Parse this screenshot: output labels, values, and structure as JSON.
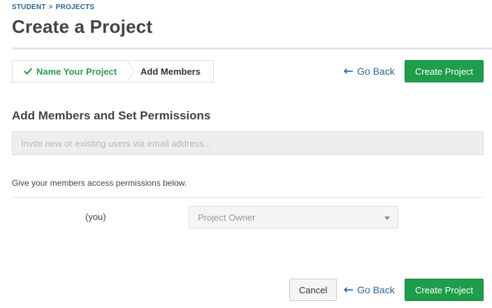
{
  "breadcrumb": {
    "root": "STUDENT",
    "separator": ">",
    "current": "PROJECTS"
  },
  "page": {
    "title": "Create a Project"
  },
  "wizard": {
    "steps": [
      {
        "label": "Name Your Project",
        "status": "done",
        "icon": "check-icon"
      },
      {
        "label": "Add Members",
        "status": "current"
      }
    ]
  },
  "actions_top": {
    "back_label": "Go Back",
    "create_label": "Create Project"
  },
  "members_section": {
    "title": "Add Members and Set Permissions",
    "invite_placeholder": "Invite new or existing users via email address...",
    "invite_value": "",
    "help_text": "Give your members access permissions below.",
    "members": [
      {
        "name": "(you)",
        "role": "Project Owner"
      }
    ]
  },
  "actions_bottom": {
    "cancel_label": "Cancel",
    "back_label": "Go Back",
    "create_label": "Create Project"
  },
  "colors": {
    "primary_green": "#1e9e4a",
    "link_blue": "#2a6496",
    "done_green": "#2e9b4e"
  }
}
